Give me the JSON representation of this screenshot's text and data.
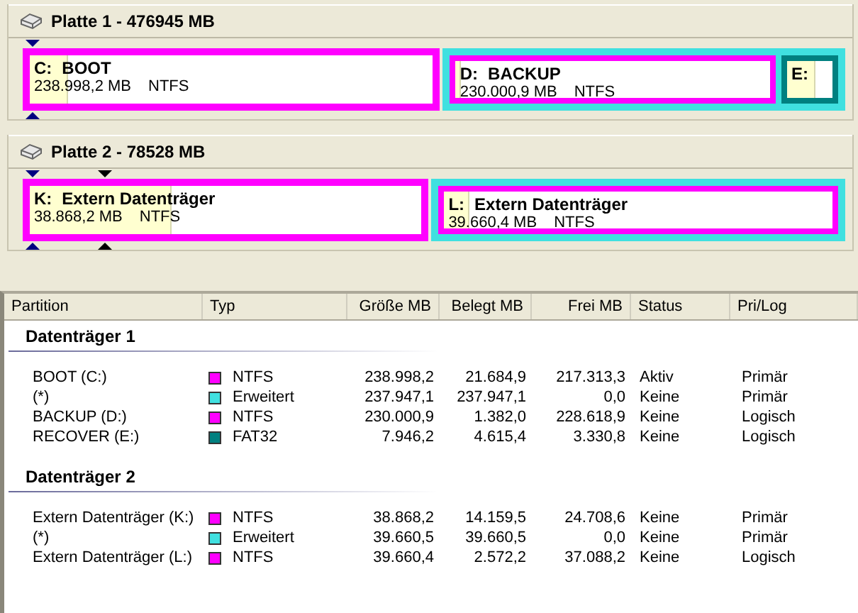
{
  "disks": [
    {
      "title": "Platte 1 - 476945 MB",
      "partitions": [
        {
          "kind": "primary",
          "letter": "C:",
          "label": "BOOT",
          "size": "238.998,2 MB",
          "fs": "NTFS",
          "color": "#ff00ff",
          "level": 0.09
        },
        {
          "kind": "extended",
          "color": "#40e0e0",
          "children": [
            {
              "kind": "logical",
              "letter": "D:",
              "label": "BACKUP",
              "size": "230.000,9 MB",
              "fs": "NTFS",
              "color": "#ff00ff",
              "level": 0.01
            },
            {
              "kind": "logical",
              "letter": "E:",
              "color": "#008080",
              "level": 0.58
            }
          ]
        }
      ]
    },
    {
      "title": "Platte 2 - 78528 MB",
      "partitions": [
        {
          "kind": "primary",
          "letter": "K:",
          "label": "Extern Datenträger",
          "size": "38.868,2 MB",
          "fs": "NTFS",
          "color": "#ff00ff",
          "level": 0.36
        },
        {
          "kind": "extended",
          "color": "#40e0e0",
          "children": [
            {
              "kind": "logical",
              "letter": "L:",
              "label": "Extern Datenträger",
              "size": "39.660,4 MB",
              "fs": "NTFS",
              "color": "#ff00ff",
              "level": 0.06
            }
          ]
        }
      ]
    }
  ],
  "table": {
    "columns": [
      "Partition",
      "Typ",
      "Größe MB",
      "Belegt MB",
      "Frei MB",
      "Status",
      "Pri/Log"
    ],
    "groups": [
      {
        "title": "Datenträger 1",
        "rows": [
          {
            "name": "BOOT (C:)",
            "type": "NTFS",
            "color": "#ff00ff",
            "size": "238.998,2",
            "used": "21.684,9",
            "free": "217.313,3",
            "status": "Aktiv",
            "prilog": "Primär"
          },
          {
            "name": "(*)",
            "type": "Erweitert",
            "color": "#40e0e0",
            "size": "237.947,1",
            "used": "237.947,1",
            "free": "0,0",
            "status": "Keine",
            "prilog": "Primär"
          },
          {
            "name": "BACKUP (D:)",
            "type": "NTFS",
            "color": "#ff00ff",
            "size": "230.000,9",
            "used": "1.382,0",
            "free": "228.618,9",
            "status": "Keine",
            "prilog": "Logisch"
          },
          {
            "name": "RECOVER (E:)",
            "type": "FAT32",
            "color": "#008080",
            "size": "7.946,2",
            "used": "4.615,4",
            "free": "3.330,8",
            "status": "Keine",
            "prilog": "Logisch"
          }
        ]
      },
      {
        "title": "Datenträger 2",
        "rows": [
          {
            "name": "Extern Datenträger (K:)",
            "type": "NTFS",
            "color": "#ff00ff",
            "size": "38.868,2",
            "used": "14.159,5",
            "free": "24.708,6",
            "status": "Keine",
            "prilog": "Primär"
          },
          {
            "name": "(*)",
            "type": "Erweitert",
            "color": "#40e0e0",
            "size": "39.660,5",
            "used": "39.660,5",
            "free": "0,0",
            "status": "Keine",
            "prilog": "Primär"
          },
          {
            "name": "Extern Datenträger (L:)",
            "type": "NTFS",
            "color": "#ff00ff",
            "size": "39.660,4",
            "used": "2.572,2",
            "free": "37.088,2",
            "status": "Keine",
            "prilog": "Logisch"
          }
        ]
      }
    ]
  }
}
